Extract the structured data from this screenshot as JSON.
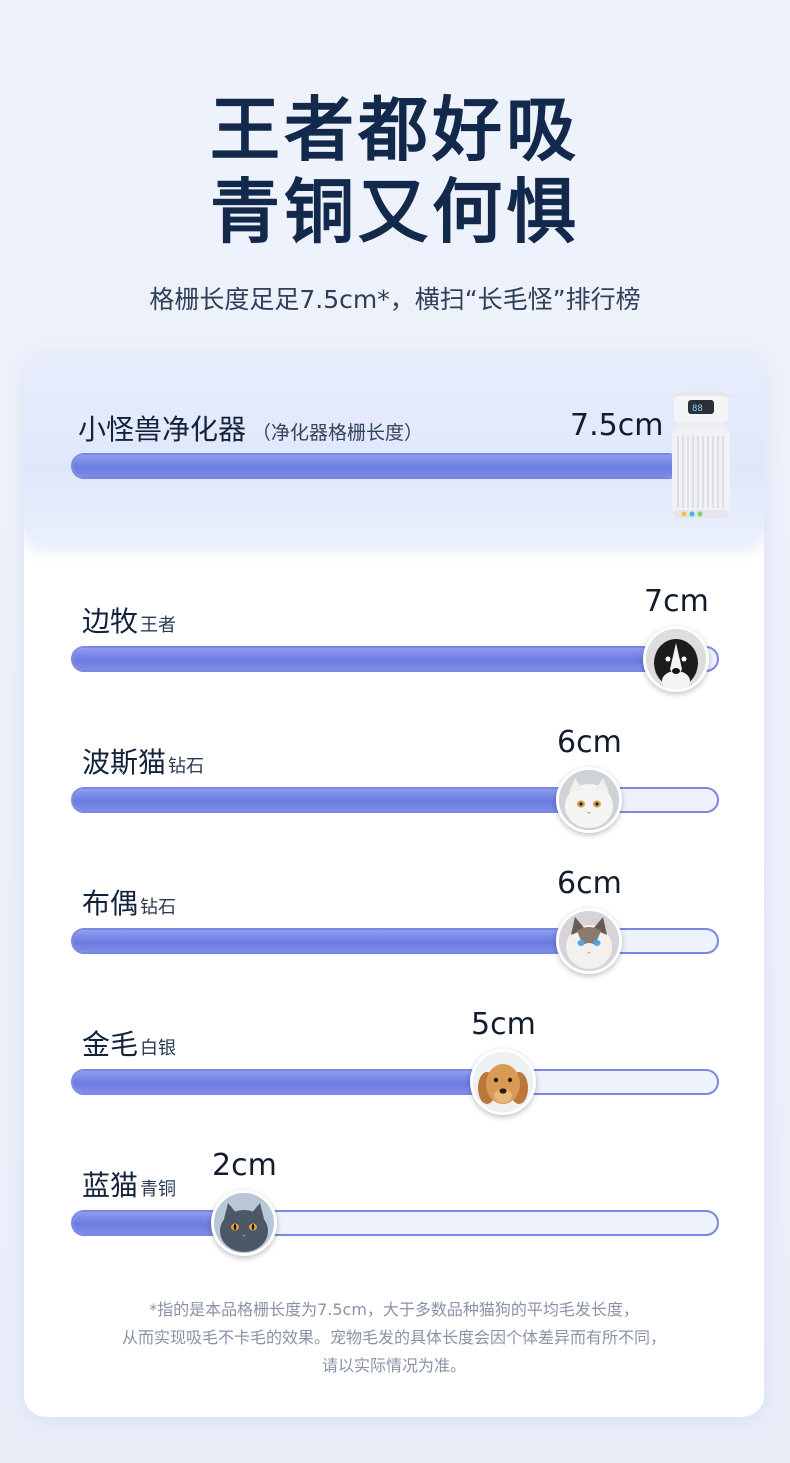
{
  "headline": {
    "line1": "王者都好吸",
    "line2": "青铜又何惧"
  },
  "subtitle": "格栅长度足足7.5cm*，横扫“长毛怪”排行榜",
  "hero": {
    "label": "小怪兽净化器",
    "sub_label": "（净化器格栅长度）",
    "value_text": "7.5cm",
    "length_cm": 7.5
  },
  "rows": [
    {
      "name": "边牧",
      "rank": "王者",
      "value_text": "7cm",
      "length_cm": 7,
      "icon": "border-collie-icon"
    },
    {
      "name": "波斯猫",
      "rank": "钻石",
      "value_text": "6cm",
      "length_cm": 6,
      "icon": "persian-cat-icon"
    },
    {
      "name": "布偶",
      "rank": "钻石",
      "value_text": "6cm",
      "length_cm": 6,
      "icon": "ragdoll-cat-icon"
    },
    {
      "name": "金毛",
      "rank": "白银",
      "value_text": "5cm",
      "length_cm": 5,
      "icon": "golden-retriever-icon"
    },
    {
      "name": "蓝猫",
      "rank": "青铜",
      "value_text": "2cm",
      "length_cm": 2,
      "icon": "british-blue-cat-icon"
    }
  ],
  "footnote": {
    "line1": "*指的是本品格栅长度为7.5cm，大于多数品种猫狗的平均毛发长度，",
    "line2": "从而实现吸毛不卡毛的效果。宠物毛发的具体长度会因个体差异而有所不同，",
    "line3": "请以实际情况为准。"
  },
  "colors": {
    "bar_fill": "#6b7be0",
    "bar_track": "#eef2fd",
    "bar_border": "#7b87e0",
    "headline": "#13294b"
  }
}
